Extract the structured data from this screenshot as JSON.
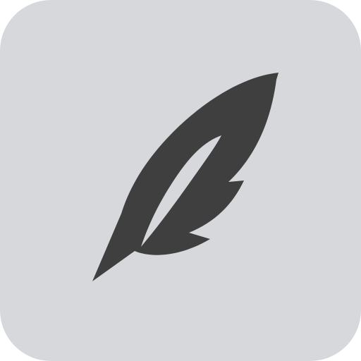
{
  "app_icon": {
    "icon": "feather-icon",
    "background_color": "#d6d8dc",
    "feather_color": "#3f3f3f"
  }
}
